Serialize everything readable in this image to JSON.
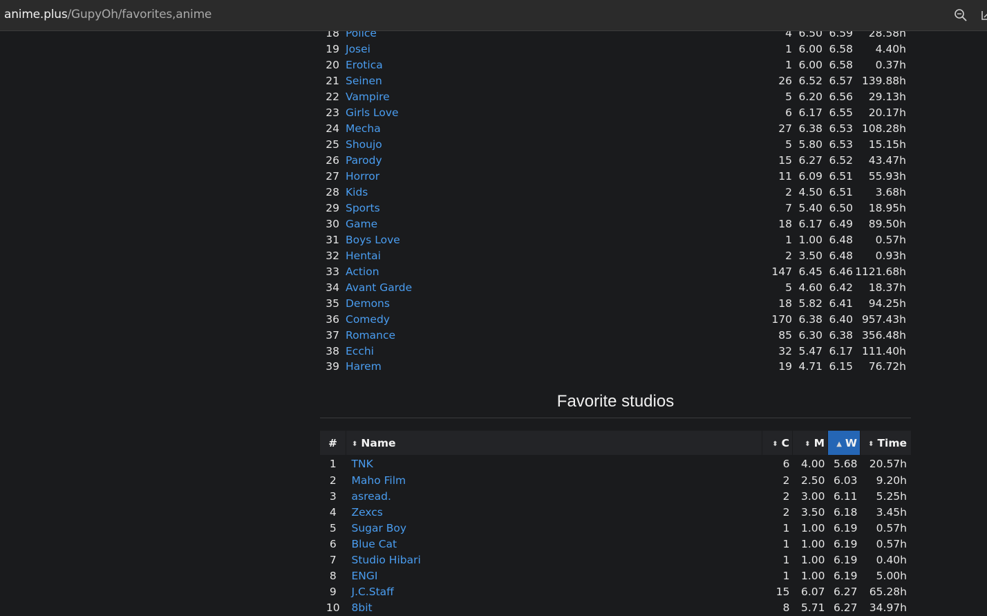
{
  "browser": {
    "url_host": "anime.plus",
    "url_path": "/GupyOh/favorites,anime"
  },
  "genres": {
    "rows": [
      {
        "rank": "18",
        "name": "Police",
        "c": "4",
        "m": "6.50",
        "w": "6.59",
        "time": "28.58h"
      },
      {
        "rank": "19",
        "name": "Josei",
        "c": "1",
        "m": "6.00",
        "w": "6.58",
        "time": "4.40h"
      },
      {
        "rank": "20",
        "name": "Erotica",
        "c": "1",
        "m": "6.00",
        "w": "6.58",
        "time": "0.37h"
      },
      {
        "rank": "21",
        "name": "Seinen",
        "c": "26",
        "m": "6.52",
        "w": "6.57",
        "time": "139.88h"
      },
      {
        "rank": "22",
        "name": "Vampire",
        "c": "5",
        "m": "6.20",
        "w": "6.56",
        "time": "29.13h"
      },
      {
        "rank": "23",
        "name": "Girls Love",
        "c": "6",
        "m": "6.17",
        "w": "6.55",
        "time": "20.17h"
      },
      {
        "rank": "24",
        "name": "Mecha",
        "c": "27",
        "m": "6.38",
        "w": "6.53",
        "time": "108.28h"
      },
      {
        "rank": "25",
        "name": "Shoujo",
        "c": "5",
        "m": "5.80",
        "w": "6.53",
        "time": "15.15h"
      },
      {
        "rank": "26",
        "name": "Parody",
        "c": "15",
        "m": "6.27",
        "w": "6.52",
        "time": "43.47h"
      },
      {
        "rank": "27",
        "name": "Horror",
        "c": "11",
        "m": "6.09",
        "w": "6.51",
        "time": "55.93h"
      },
      {
        "rank": "28",
        "name": "Kids",
        "c": "2",
        "m": "4.50",
        "w": "6.51",
        "time": "3.68h"
      },
      {
        "rank": "29",
        "name": "Sports",
        "c": "7",
        "m": "5.40",
        "w": "6.50",
        "time": "18.95h"
      },
      {
        "rank": "30",
        "name": "Game",
        "c": "18",
        "m": "6.17",
        "w": "6.49",
        "time": "89.50h"
      },
      {
        "rank": "31",
        "name": "Boys Love",
        "c": "1",
        "m": "1.00",
        "w": "6.48",
        "time": "0.57h"
      },
      {
        "rank": "32",
        "name": "Hentai",
        "c": "2",
        "m": "3.50",
        "w": "6.48",
        "time": "0.93h"
      },
      {
        "rank": "33",
        "name": "Action",
        "c": "147",
        "m": "6.45",
        "w": "6.46",
        "time": "1121.68h"
      },
      {
        "rank": "34",
        "name": "Avant Garde",
        "c": "5",
        "m": "4.60",
        "w": "6.42",
        "time": "18.37h"
      },
      {
        "rank": "35",
        "name": "Demons",
        "c": "18",
        "m": "5.82",
        "w": "6.41",
        "time": "94.25h"
      },
      {
        "rank": "36",
        "name": "Comedy",
        "c": "170",
        "m": "6.38",
        "w": "6.40",
        "time": "957.43h"
      },
      {
        "rank": "37",
        "name": "Romance",
        "c": "85",
        "m": "6.30",
        "w": "6.38",
        "time": "356.48h"
      },
      {
        "rank": "38",
        "name": "Ecchi",
        "c": "32",
        "m": "5.47",
        "w": "6.17",
        "time": "111.40h"
      },
      {
        "rank": "39",
        "name": "Harem",
        "c": "19",
        "m": "4.71",
        "w": "6.15",
        "time": "76.72h"
      }
    ]
  },
  "studios": {
    "title": "Favorite studios",
    "headers": {
      "rank": "#",
      "name": "Name",
      "c": "C",
      "m": "M",
      "w": "W",
      "time": "Time"
    },
    "sort_icons": {
      "both": "⬍",
      "asc": "▲"
    },
    "rows": [
      {
        "rank": "1",
        "name": "TNK",
        "c": "6",
        "m": "4.00",
        "w": "5.68",
        "time": "20.57h"
      },
      {
        "rank": "2",
        "name": "Maho Film",
        "c": "2",
        "m": "2.50",
        "w": "6.03",
        "time": "9.20h"
      },
      {
        "rank": "3",
        "name": "asread.",
        "c": "2",
        "m": "3.00",
        "w": "6.11",
        "time": "5.25h"
      },
      {
        "rank": "4",
        "name": "Zexcs",
        "c": "2",
        "m": "3.50",
        "w": "6.18",
        "time": "3.45h"
      },
      {
        "rank": "5",
        "name": "Sugar Boy",
        "c": "1",
        "m": "1.00",
        "w": "6.19",
        "time": "0.57h"
      },
      {
        "rank": "6",
        "name": "Blue Cat",
        "c": "1",
        "m": "1.00",
        "w": "6.19",
        "time": "0.57h"
      },
      {
        "rank": "7",
        "name": "Studio Hibari",
        "c": "1",
        "m": "1.00",
        "w": "6.19",
        "time": "0.40h"
      },
      {
        "rank": "8",
        "name": "ENGI",
        "c": "1",
        "m": "1.00",
        "w": "6.19",
        "time": "5.00h"
      },
      {
        "rank": "9",
        "name": "J.C.Staff",
        "c": "15",
        "m": "6.07",
        "w": "6.27",
        "time": "65.28h"
      },
      {
        "rank": "10",
        "name": "8bit",
        "c": "8",
        "m": "5.71",
        "w": "6.27",
        "time": "34.97h"
      }
    ]
  }
}
